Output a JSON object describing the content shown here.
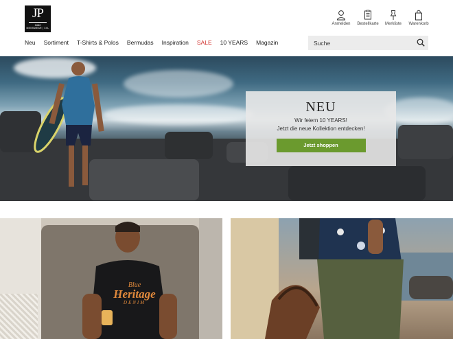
{
  "brand": {
    "logo_monogram": "JP",
    "logo_year": "1880",
    "logo_tagline": "MENSWEAR | XXL"
  },
  "utility_nav": [
    {
      "label": "Anmelden",
      "icon": "user-icon"
    },
    {
      "label": "Bestellkarte",
      "icon": "order-card-icon"
    },
    {
      "label": "Merkliste",
      "icon": "wishlist-icon"
    },
    {
      "label": "Warenkorb",
      "icon": "shopping-bag-icon"
    }
  ],
  "main_nav": [
    {
      "label": "Neu"
    },
    {
      "label": "Sortiment"
    },
    {
      "label": "T-Shirts & Polos"
    },
    {
      "label": "Bermudas"
    },
    {
      "label": "Inspiration"
    },
    {
      "label": "SALE"
    },
    {
      "label": "10 YEARS"
    },
    {
      "label": "Magazin"
    }
  ],
  "search": {
    "placeholder": "Suche",
    "icon": "search-icon"
  },
  "hero": {
    "title": "NEU",
    "line1": "Wir feiern 10 YEARS!",
    "line2": "Jetzt die neue Kollektion entdecken!",
    "button_label": "Jetzt shoppen"
  },
  "tiles": {
    "left_shirt_line1": "Blue",
    "left_shirt_line2": "Heritage",
    "left_shirt_line3": "DENIM"
  },
  "colors": {
    "sale": "#d0312d",
    "cta_green": "#6b9a2e",
    "search_bg": "#ececec"
  }
}
